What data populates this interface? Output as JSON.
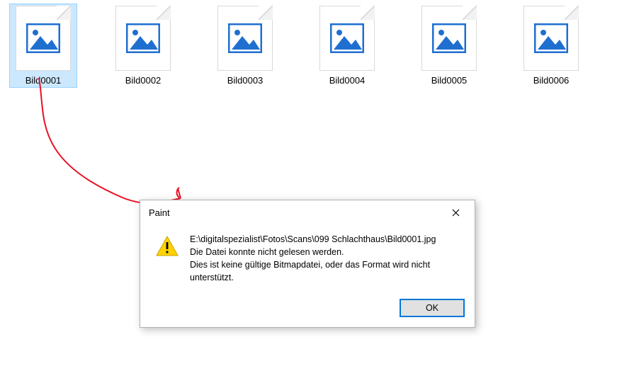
{
  "files": [
    {
      "label": "Bild0001",
      "selected": true
    },
    {
      "label": "Bild0002",
      "selected": false
    },
    {
      "label": "Bild0003",
      "selected": false
    },
    {
      "label": "Bild0004",
      "selected": false
    },
    {
      "label": "Bild0005",
      "selected": false
    },
    {
      "label": "Bild0006",
      "selected": false
    }
  ],
  "dialog": {
    "title": "Paint",
    "line1": "E:\\digitalspezialist\\Fotos\\Scans\\099 Schlachthaus\\Bild0001.jpg",
    "line2": "Die Datei konnte nicht gelesen werden.",
    "line3": "Dies ist keine gültige Bitmapdatei, oder das Format wird nicht unterstützt.",
    "ok_label": "OK"
  },
  "colors": {
    "selection_bg": "#cce8ff",
    "accent": "#0078d7",
    "arrow": "#e81123",
    "icon_blue": "#1f6fd0"
  }
}
